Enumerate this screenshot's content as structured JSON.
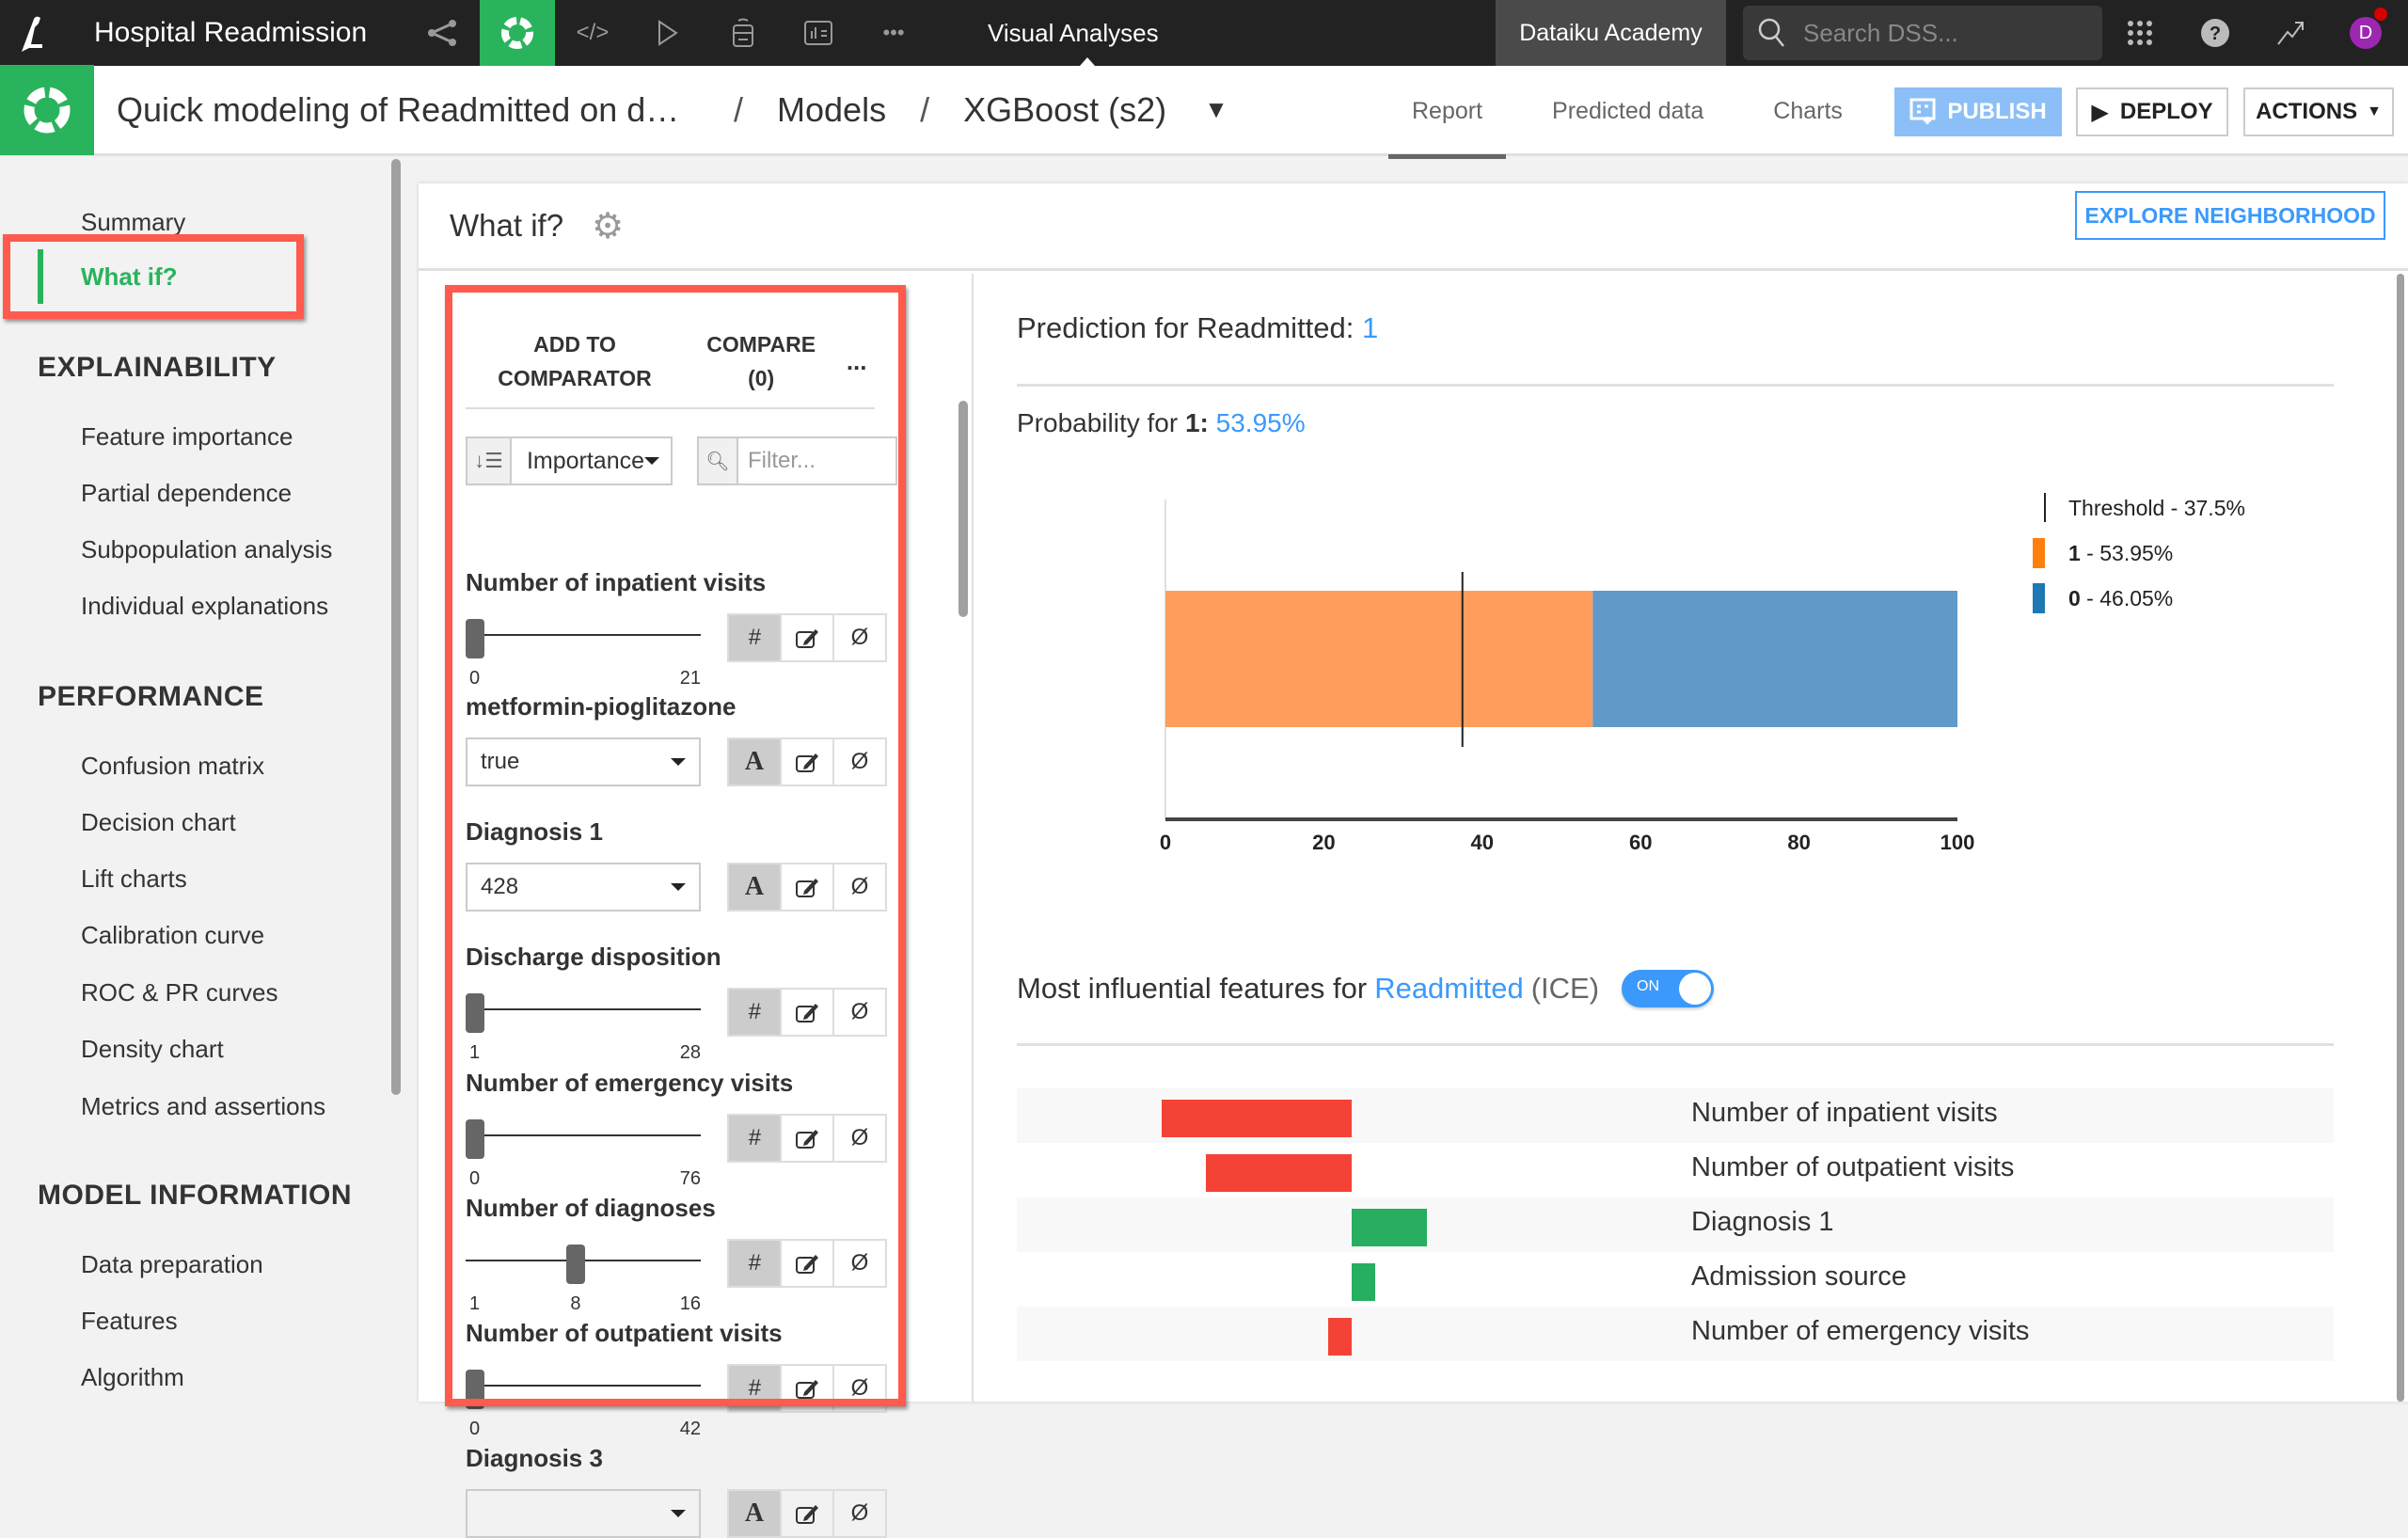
{
  "topbar": {
    "project_name": "Hospital Readmission",
    "section": "Visual Analyses",
    "instance": "Dataiku Academy",
    "search_placeholder": "Search DSS...",
    "avatar_initial": "D",
    "nav_icons": [
      "flow-icon",
      "ml-icon",
      "code-icon",
      "run-icon",
      "datasets-icon",
      "dashboard-icon",
      "more-icon"
    ]
  },
  "subbar": {
    "breadcrumb": [
      "Quick modeling of Readmitted on d…",
      "Models",
      "XGBoost (s2)"
    ],
    "tabs": [
      "Report",
      "Predicted data",
      "Charts"
    ],
    "active_tab": "Report",
    "publish": "PUBLISH",
    "deploy": "DEPLOY",
    "actions": "ACTIONS"
  },
  "sidebar": {
    "top_items": [
      "Summary",
      "What if?"
    ],
    "active_item": "What if?",
    "sections": [
      {
        "heading": "EXPLAINABILITY",
        "items": [
          "Feature importance",
          "Partial dependence",
          "Subpopulation analysis",
          "Individual explanations"
        ]
      },
      {
        "heading": "PERFORMANCE",
        "items": [
          "Confusion matrix",
          "Decision chart",
          "Lift charts",
          "Calibration curve",
          "ROC & PR curves",
          "Density chart",
          "Metrics and assertions"
        ]
      },
      {
        "heading": "MODEL INFORMATION",
        "items": [
          "Data preparation",
          "Features",
          "Algorithm"
        ]
      }
    ]
  },
  "main": {
    "title": "What if?",
    "explore_button": "EXPLORE NEIGHBORHOOD",
    "panel": {
      "add_to_comparator": "ADD TO COMPARATOR",
      "add_line1": "ADD TO",
      "add_line2": "COMPARATOR",
      "compare_line1": "COMPARE",
      "compare_line2": "(0)",
      "more": "...",
      "sort_value": "Importance",
      "filter_placeholder": "Filter...",
      "features": [
        {
          "name": "Number of inpatient visits",
          "kind": "numeric",
          "min": "0",
          "max": "21",
          "value": 0
        },
        {
          "name": "metformin-pioglitazone",
          "kind": "categorical",
          "value": "true"
        },
        {
          "name": "Diagnosis 1",
          "kind": "categorical",
          "value": "428"
        },
        {
          "name": "Discharge disposition",
          "kind": "numeric",
          "min": "1",
          "max": "28",
          "value": 1
        },
        {
          "name": "Number of emergency visits",
          "kind": "numeric",
          "min": "0",
          "max": "76",
          "value": 0
        },
        {
          "name": "Number of diagnoses",
          "kind": "numeric",
          "min": "1",
          "max": "16",
          "value": 8,
          "value_label": "8"
        },
        {
          "name": "Number of outpatient visits",
          "kind": "numeric",
          "min": "0",
          "max": "42",
          "value": 0
        },
        {
          "name": "Diagnosis 3",
          "kind": "categorical",
          "value": ""
        }
      ],
      "type_icons": {
        "numeric": "#",
        "categorical": "A",
        "edit": "edit-icon",
        "null": "Ø"
      }
    },
    "prediction": {
      "label": "Prediction for Readmitted:",
      "value": "1",
      "prob_label": "Probability for",
      "prob_class": "1:",
      "prob_value": "53.95%"
    },
    "ice": {
      "title": "Most influential features for",
      "target": "Readmitted",
      "suffix": "(ICE)",
      "toggle": "ON"
    }
  },
  "colors": {
    "accent_green": "#2ab35d",
    "link_blue": "#3b99fc",
    "class_1": "#ff7f0e",
    "class_0": "#1f77b4",
    "negative": "#f44336",
    "positive": "#27ae60",
    "highlight": "#ff5a4c"
  },
  "chart_data": [
    {
      "type": "bar",
      "orientation": "horizontal-stacked",
      "title": "Probability for 1: 53.95%",
      "series": [
        {
          "name": "1 - 53.95%",
          "value": 53.95,
          "color": "#ff7f0e"
        },
        {
          "name": "0 - 46.05%",
          "value": 46.05,
          "color": "#1f77b4"
        }
      ],
      "threshold": {
        "label": "Threshold - 37.5%",
        "value": 37.5
      },
      "xlim": [
        0,
        100
      ],
      "xticks": [
        "0",
        "20",
        "40",
        "60",
        "80",
        "100"
      ],
      "legend": "right"
    },
    {
      "type": "bar",
      "orientation": "horizontal-diverging",
      "title": "Most influential features for Readmitted (ICE)",
      "categories": [
        "Number of inpatient visits",
        "Number of outpatient visits",
        "Diagnosis 1",
        "Admission source",
        "Number of emergency visits"
      ],
      "values": [
        -0.48,
        -0.37,
        0.19,
        0.06,
        -0.06
      ],
      "units": "relative contribution (unlabeled axis)"
    }
  ]
}
